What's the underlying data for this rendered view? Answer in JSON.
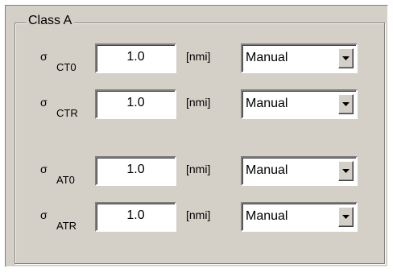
{
  "group": {
    "title": "Class A"
  },
  "rows": [
    {
      "symbol": "σ",
      "subscript": "CT0",
      "value": "1.0",
      "unit": "[nmi]",
      "mode": "Manual"
    },
    {
      "symbol": "σ",
      "subscript": "CTR",
      "value": "1.0",
      "unit": "[nmi]",
      "mode": "Manual"
    },
    {
      "symbol": "σ",
      "subscript": "AT0",
      "value": "1.0",
      "unit": "[nmi]",
      "mode": "Manual"
    },
    {
      "symbol": "σ",
      "subscript": "ATR",
      "value": "1.0",
      "unit": "[nmi]",
      "mode": "Manual"
    }
  ],
  "icons": {
    "dropdown": "chevron-down-icon"
  },
  "colors": {
    "panel_background": "#d4d0c8",
    "field_background": "#ffffff",
    "shadow": "#808080",
    "highlight": "#ffffff",
    "text": "#000000"
  }
}
